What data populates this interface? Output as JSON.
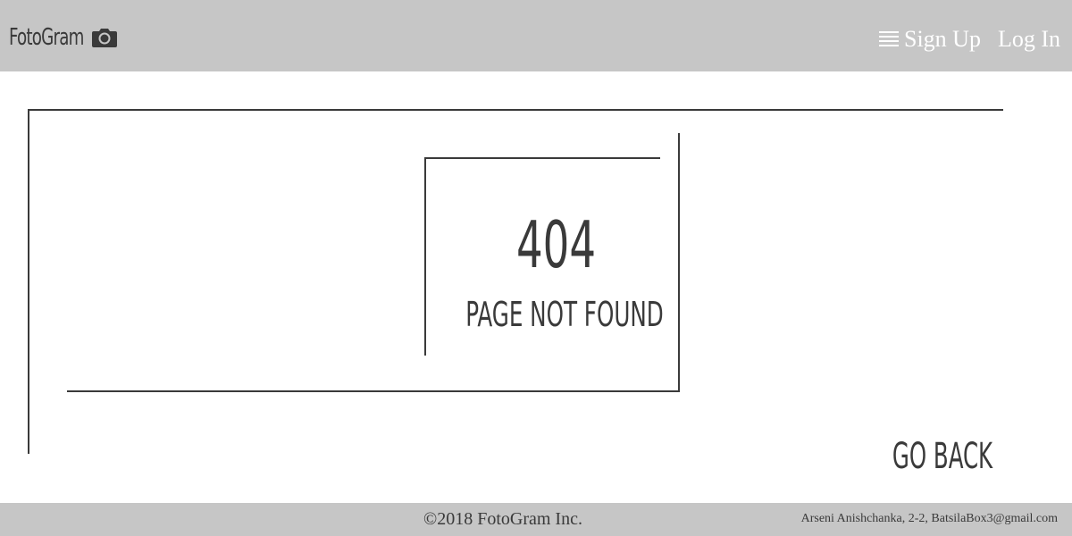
{
  "header": {
    "brand_name": "FotoGram",
    "brand_icon": "camera-icon",
    "nav": {
      "menu_icon": "hamburger-menu-icon",
      "signup_label": "Sign Up",
      "login_label": "Log In"
    }
  },
  "main": {
    "error_code": "404",
    "error_message": "PAGE NOT FOUND",
    "go_back_label": "GO BACK"
  },
  "footer": {
    "copyright": "©2018 FotoGram Inc.",
    "credits": "Arseni Anishchanka, 2-2, BatsilaBox3@gmail.com"
  },
  "colors": {
    "header_background": "#c6c6c6",
    "footer_background": "#c6c6c6",
    "text_dark": "#3a3a3a",
    "nav_text": "#ffffff",
    "page_background": "#ffffff"
  }
}
